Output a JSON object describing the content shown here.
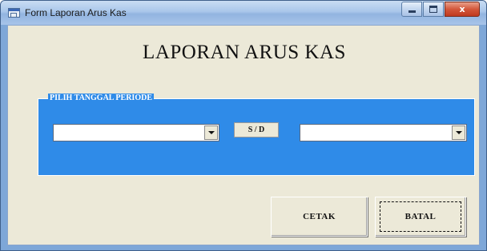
{
  "window": {
    "title": "Form Laporan Arus Kas",
    "icon": "form-icon",
    "controls": {
      "minimize": "minimize-icon",
      "maximize": "maximize-icon",
      "close": "x"
    }
  },
  "form": {
    "heading": "LAPORAN ARUS KAS",
    "period_group_label": "PILIH TANGGAL PERIODE",
    "start_date": {
      "value": ""
    },
    "separator_label": "S / D",
    "end_date": {
      "value": ""
    }
  },
  "buttons": {
    "print_label": "CETAK",
    "cancel_label": "BATAL"
  },
  "colors": {
    "frame_blue": "#2f8be8",
    "dialog_face": "#ece9d8",
    "close_red": "#c0391f"
  }
}
